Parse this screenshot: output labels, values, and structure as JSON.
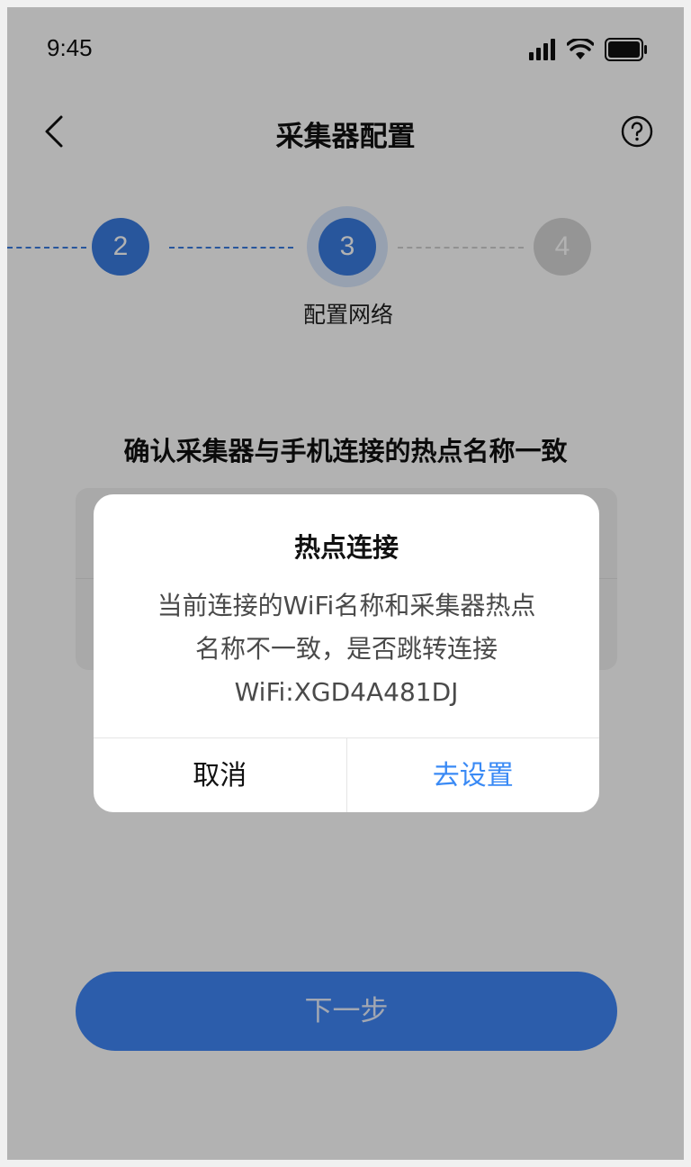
{
  "status_bar": {
    "time": "9:45"
  },
  "nav": {
    "title": "采集器配置"
  },
  "stepper": {
    "steps": [
      {
        "number": "2"
      },
      {
        "number": "3",
        "label": "配置网络"
      },
      {
        "number": "4"
      }
    ],
    "current_step": "3"
  },
  "main": {
    "instruction": "确认采集器与手机连接的热点名称一致"
  },
  "footer": {
    "next_label": "下一步"
  },
  "dialog": {
    "title": "热点连接",
    "message_lines": [
      "当前连接的WiFi名称和采集器热点",
      "名称不一致，是否跳转连接",
      "WiFi:XGD4A481DJ"
    ],
    "cancel_label": "取消",
    "confirm_label": "去设置"
  },
  "colors": {
    "accent": "#3a7be0",
    "primary_button": "#3f86f5",
    "dialog_confirm": "#3a8af5",
    "inactive_step": "#d6d6d6",
    "overlay": "rgba(0,0,0,0.30)"
  },
  "icons": [
    "signal-icon",
    "wifi-icon",
    "battery-icon",
    "back-icon",
    "help-icon"
  ]
}
